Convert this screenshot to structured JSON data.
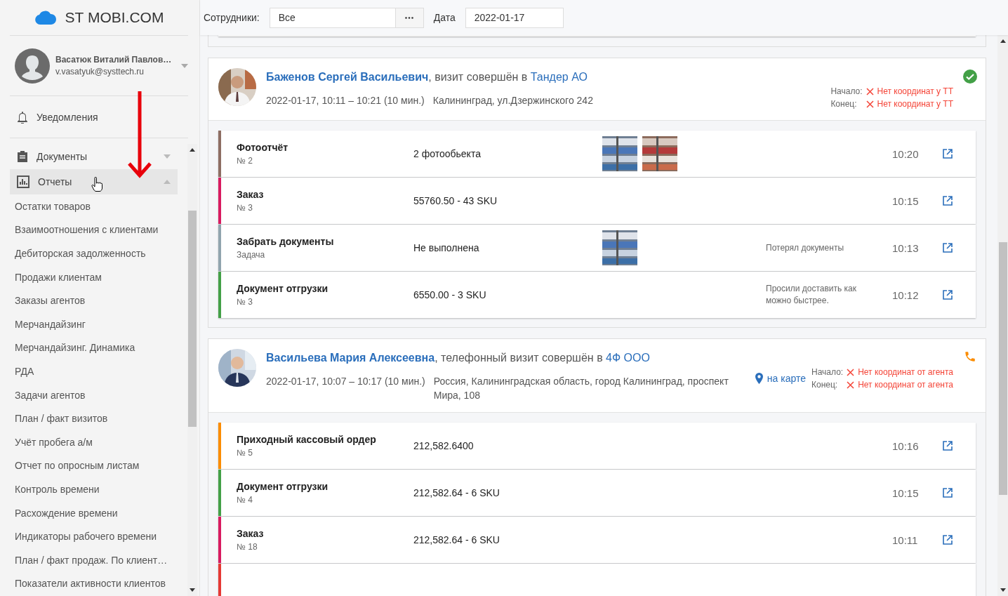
{
  "brand": {
    "name": "ST MOBI.COM"
  },
  "user": {
    "name": "Васатюк Виталий Павлов…",
    "email": "v.vasatyuk@systtech.ru"
  },
  "nav": [
    {
      "kind": "bell",
      "label": "Уведомления",
      "selected": false
    },
    {
      "kind": "document",
      "label": "Документы",
      "selected": false,
      "expanded": false
    },
    {
      "kind": "chart",
      "label": "Отчеты",
      "selected": true,
      "expanded": true,
      "children": [
        "Остатки товаров",
        "Взаимоотношения с клиентами",
        "Дебиторская задолженность",
        "Продажи клиентам",
        "Заказы агентов",
        "Мерчандайзинг",
        "Мерчандайзинг. Динамика",
        "РДА",
        "Задачи агентов",
        "План / факт визитов",
        "Учёт пробега а/м",
        "Отчет по опросным листам",
        "Контроль времени",
        "Расхождение времени",
        "Индикаторы рабочего времени",
        "План / факт продаж. По клиент…",
        "Показатели активности клиентов"
      ]
    }
  ],
  "filters": {
    "employees_label": "Сотрудники:",
    "employees_value": "Все",
    "date_label": "Дата",
    "date_value": "2022-01-17"
  },
  "visits": [
    {
      "agent": "Баженов Сергей Васильевич",
      "action": ", визит совершён в ",
      "client": "Тандер АО",
      "datetime": "2022-01-17, 10:11 – 10:21 (10 мин.)",
      "address": "Калининград, ул.Дзержинского 242",
      "kind": "done",
      "start_label": "Начало:",
      "start_value": "Нет координат у ТТ",
      "end_label": "Конец:",
      "end_value": "Нет координат у ТТ",
      "items": [
        {
          "title": "Фотоотчёт",
          "subtitle": "№ 2",
          "value": "2 фотообьекта",
          "color": "#8d6e63",
          "time": "10:20"
        },
        {
          "title": "Заказ",
          "subtitle": "№ 3",
          "value": "55760.50 - 43 SKU",
          "color": "#d81b60",
          "time": "10:15"
        },
        {
          "title": "Забрать документы",
          "subtitle": "Задача",
          "value": "Не выполнена",
          "color": "#90a4ae",
          "note": "Потерял документы",
          "time": "10:13"
        },
        {
          "title": "Документ отгрузки",
          "subtitle": "№ 3",
          "value": "6550.00 - 3 SKU",
          "color": "#43a047",
          "note": "Просили доставить как можно быстрее.",
          "time": "10:12"
        }
      ]
    },
    {
      "agent": "Васильева Мария Алексеевна",
      "action": ", телефонный визит совершён в ",
      "client": "4Ф ООО",
      "datetime": "2022-01-17, 10:07 – 10:17 (10 мин.)",
      "address": "Россия, Калининградская область, город Калининград, проспект Мира, 108",
      "map_link": "на карте",
      "kind": "phone",
      "start_label": "Начало:",
      "start_value": "Нет координат от агента",
      "end_label": "Конец:",
      "end_value": "Нет координат от агента",
      "items": [
        {
          "title": "Приходный кассовый ордер",
          "subtitle": "№ 5",
          "value": "212,582.6400",
          "color": "#fb8c00",
          "time": "10:16"
        },
        {
          "title": "Документ отгрузки",
          "subtitle": "№ 4",
          "value": "212,582.64 - 6 SKU",
          "color": "#43a047",
          "time": "10:15"
        },
        {
          "title": "Заказ",
          "subtitle": "№ 18",
          "value": "212,582.64 - 6 SKU",
          "color": "#d81b60",
          "time": "10:11"
        },
        {
          "color": "#e53935"
        }
      ]
    }
  ]
}
